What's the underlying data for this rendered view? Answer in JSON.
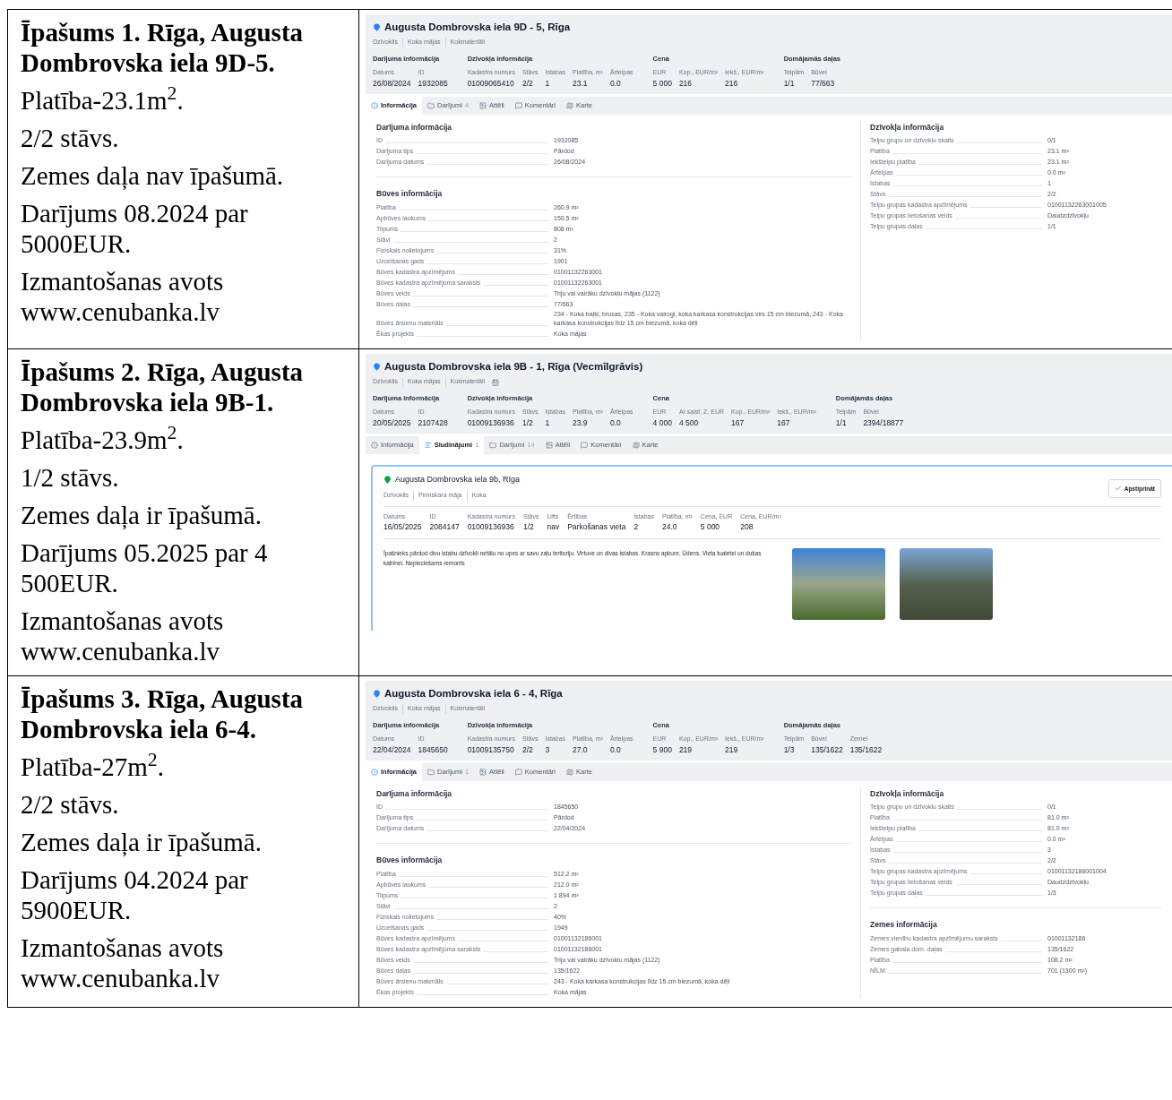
{
  "rows": [
    {
      "property": {
        "title": "Īpašums 1. Rīga, Augusta Dombrovska iela 9D-5.",
        "lines": [
          "Platība-23.1m$^{2}$.",
          "2/2 stāvs.",
          "Zemes daļa nav īpašumā.",
          "Darījums 08.2024 par 5000EUR.",
          "Izmantošanas avots www.cenubanka.lv"
        ]
      },
      "screenshot": {
        "address": "Augusta Dombrovska iela 9D - 5, Rīga",
        "tags": [
          "Dzīvoklis",
          "Koka mājas",
          "Kokmateriāli"
        ],
        "extra_icon": false,
        "summary": [
          {
            "title": "Darījuma informācija",
            "fields": [
              {
                "label": "Datums",
                "value": "26/08/2024"
              },
              {
                "label": "ID",
                "value": "1932085"
              }
            ]
          },
          {
            "title": "Dzīvokļa informācija",
            "fields": [
              {
                "label": "Kadastra numurs",
                "value": "01009065410"
              },
              {
                "label": "Stāvs",
                "value": "2/2"
              },
              {
                "label": "Istabas",
                "value": "1"
              },
              {
                "label": "Platība, m²",
                "value": "23.1"
              },
              {
                "label": "Ārtelpas",
                "value": "0.0"
              }
            ]
          },
          {
            "title": "Cena",
            "fields": [
              {
                "label": "EUR",
                "value": "5 000"
              },
              {
                "label": "Kop., EUR/m²",
                "value": "216"
              },
              {
                "label": "Iekš., EUR/m²",
                "value": "216"
              }
            ]
          },
          {
            "title": "Domājamās daļas",
            "fields": [
              {
                "label": "Telpām",
                "value": "1/1"
              },
              {
                "label": "Būvei",
                "value": "77/663"
              }
            ]
          }
        ],
        "tabs": [
          {
            "kind": "info",
            "label": "Informācija",
            "selected": true
          },
          {
            "kind": "deals",
            "label": "Darījumi",
            "count": "4",
            "selected": false
          },
          {
            "kind": "images",
            "label": "Attēli",
            "selected": false
          },
          {
            "kind": "comments",
            "label": "Komentāri",
            "selected": false
          },
          {
            "kind": "map",
            "label": "Karte",
            "selected": false
          }
        ],
        "body": {
          "kind": "info",
          "columns": [
            [
              {
                "title": "Darījuma informācija",
                "rows": [
                  {
                    "label": "ID",
                    "value": "1932085"
                  },
                  {
                    "label": "Darījuma tips",
                    "value": "Pārdod"
                  },
                  {
                    "label": "Darījuma datums",
                    "value": "26/08/2024"
                  }
                ]
              },
              {
                "title": "Būves informācija",
                "rows": [
                  {
                    "label": "Platība",
                    "value": "260.9 m²"
                  },
                  {
                    "label": "Apbūves laukums",
                    "value": "150.5 m²"
                  },
                  {
                    "label": "Tilpums",
                    "value": "808 m³"
                  },
                  {
                    "label": "Stāvi",
                    "value": "2"
                  },
                  {
                    "label": "Fiziskais nolietojums",
                    "value": "31%"
                  },
                  {
                    "label": "Uzcelšanas gads",
                    "value": "1901"
                  },
                  {
                    "label": "Būves kadastra apzīmējums",
                    "value": "01001132263001"
                  },
                  {
                    "label": "Būves kadastra apzīmējuma saraksts",
                    "value": "01001132263001"
                  },
                  {
                    "label": "Būves veids",
                    "value": "Triju vai vairāku dzīvokļu mājas (1122)"
                  },
                  {
                    "label": "Būves daļas",
                    "value": "77/663"
                  },
                  {
                    "label": "Būves ārsienu materiāls",
                    "value": "234 - Koka baļķi, brusas, 235 - Koka vairogi, koka karkasa konstrukcijas virs 15 cm biezumā, 243 - Koka karkasa konstrukcijas līdz 15 cm biezumā, koka dēļi"
                  },
                  {
                    "label": "Ēkas projekts",
                    "value": "Koka mājas"
                  }
                ]
              }
            ],
            [
              {
                "title": "Dzīvokļa informācija",
                "rows": [
                  {
                    "label": "Telpu grupu un dzīvokļu skaits",
                    "value": "0/1"
                  },
                  {
                    "label": "Platība",
                    "value": "23.1 m²"
                  },
                  {
                    "label": "Iekštelpu platība",
                    "value": "23.1 m²"
                  },
                  {
                    "label": "Ārtelpas",
                    "value": "0.0 m²"
                  },
                  {
                    "label": "Istabas",
                    "value": "1"
                  },
                  {
                    "label": "Stāvs",
                    "value": "2/2"
                  },
                  {
                    "label": "Telpu grupas kadastra apzīmējums",
                    "value": "01001132263001005"
                  },
                  {
                    "label": "Telpu grupas lietošanas veids",
                    "value": "Daudzdzīvokļu"
                  },
                  {
                    "label": "Telpu grupas daļas",
                    "value": "1/1"
                  }
                ]
              }
            ]
          ]
        }
      }
    },
    {
      "property": {
        "title": "Īpašums 2. Rīga, Augusta Dombrovska iela 9B-1.",
        "lines": [
          "Platība-23.9m$^{2}$.",
          "1/2 stāvs.",
          "Zemes daļa ir īpašumā.",
          "Darījums 05.2025 par 4 500EUR.",
          "Izmantošanas avots www.cenubanka.lv"
        ]
      },
      "screenshot": {
        "address": "Augusta Dombrovska iela 9B - 1, Rīga (Vecmīlgrāvis)",
        "tags": [
          "Dzīvoklis",
          "Koka mājas",
          "Kokmateriāli"
        ],
        "extra_icon": true,
        "summary": [
          {
            "title": "Darījuma informācija",
            "fields": [
              {
                "label": "Datums",
                "value": "20/05/2025"
              },
              {
                "label": "ID",
                "value": "2107428"
              }
            ]
          },
          {
            "title": "Dzīvokļa informācija",
            "fields": [
              {
                "label": "Kadastra numurs",
                "value": "01009136936"
              },
              {
                "label": "Stāvs",
                "value": "1/2"
              },
              {
                "label": "Istabas",
                "value": "1"
              },
              {
                "label": "Platība, m²",
                "value": "23.9"
              },
              {
                "label": "Ārtelpas",
                "value": "0.0"
              }
            ]
          },
          {
            "title": "Cena",
            "fields": [
              {
                "label": "EUR",
                "value": "4 000"
              },
              {
                "label": "Ar saist. Z, EUR",
                "value": "4 500"
              },
              {
                "label": "Kop., EUR/m²",
                "value": "167"
              },
              {
                "label": "Iekš., EUR/m²",
                "value": "167"
              }
            ]
          },
          {
            "title": "Domājamās daļas",
            "fields": [
              {
                "label": "Telpām",
                "value": "1/1"
              },
              {
                "label": "Būvei",
                "value": "2394/18877"
              }
            ]
          }
        ],
        "tabs": [
          {
            "kind": "info",
            "label": "Informācija",
            "selected": false
          },
          {
            "kind": "listings",
            "label": "Sludinājumi",
            "count": "1",
            "selected": true
          },
          {
            "kind": "deals",
            "label": "Darījumi",
            "count": "14",
            "selected": false
          },
          {
            "kind": "images",
            "label": "Attēli",
            "selected": false
          },
          {
            "kind": "comments",
            "label": "Komentāri",
            "selected": false
          },
          {
            "kind": "map",
            "label": "Karte",
            "selected": false
          }
        ],
        "body": {
          "kind": "listing",
          "address": "Augusta Dombrovska iela 9b, Rīga",
          "tags": [
            "Dzīvoklis",
            "Pirmskara māja",
            "Koka"
          ],
          "button": "Apstiprināt",
          "fields": [
            {
              "label": "Datums",
              "value": "16/05/2025"
            },
            {
              "label": "ID",
              "value": "2084147"
            },
            {
              "label": "Kadastra numurs",
              "value": "01009136936"
            },
            {
              "label": "Stāvs",
              "value": "1/2"
            },
            {
              "label": "Lifts",
              "value": "nav"
            },
            {
              "label": "Ērtības",
              "value": "Parkošanas vieta"
            },
            {
              "label": "Istabas",
              "value": "2"
            },
            {
              "label": "Platība, m²",
              "value": "24.0"
            },
            {
              "label": "Cena, EUR",
              "value": "5 000"
            },
            {
              "label": "Cena, EUR/m²",
              "value": "208"
            }
          ],
          "description": "Īpašnieks pārdod divu istabu dzīvokli netālu no upes ar savu zaļu teritoriju. Virtuve un divas istabas. Krasns apkure. Ūdens. Vieta tualetei un dušas kabīnei. Nepieciešams remonts"
        }
      }
    },
    {
      "property": {
        "title": "Īpašums 3. Rīga, Augusta Dombrovska iela 6-4.",
        "lines": [
          "Platība-27m$^{2}$.",
          "2/2 stāvs.",
          "Zemes daļa ir īpašumā.",
          "Darījums 04.2024 par 5900EUR.",
          "Izmantošanas avots www.cenubanka.lv"
        ]
      },
      "screenshot": {
        "address": "Augusta Dombrovska iela 6 - 4, Rīga",
        "tags": [
          "Dzīvoklis",
          "Koka mājas",
          "Kokmateriāli"
        ],
        "extra_icon": false,
        "summary": [
          {
            "title": "Darījuma informācija",
            "fields": [
              {
                "label": "Datums",
                "value": "22/04/2024"
              },
              {
                "label": "ID",
                "value": "1845650"
              }
            ]
          },
          {
            "title": "Dzīvokļa informācija",
            "fields": [
              {
                "label": "Kadastra numurs",
                "value": "01009135750"
              },
              {
                "label": "Stāvs",
                "value": "2/2"
              },
              {
                "label": "Istabas",
                "value": "3"
              },
              {
                "label": "Platība, m²",
                "value": "27.0"
              },
              {
                "label": "Ārtelpas",
                "value": "0.0"
              }
            ]
          },
          {
            "title": "Cena",
            "fields": [
              {
                "label": "EUR",
                "value": "5 900"
              },
              {
                "label": "Kop., EUR/m²",
                "value": "219"
              },
              {
                "label": "Iekš., EUR/m²",
                "value": "219"
              }
            ]
          },
          {
            "title": "Domājamās daļas",
            "fields": [
              {
                "label": "Telpām",
                "value": "1/3"
              },
              {
                "label": "Būvei",
                "value": "135/1622"
              },
              {
                "label": "Zemei",
                "value": "135/1622"
              }
            ]
          }
        ],
        "tabs": [
          {
            "kind": "info",
            "label": "Informācija",
            "selected": true
          },
          {
            "kind": "deals",
            "label": "Darījumi",
            "count": "1",
            "selected": false
          },
          {
            "kind": "images",
            "label": "Attēli",
            "selected": false
          },
          {
            "kind": "comments",
            "label": "Komentāri",
            "selected": false
          },
          {
            "kind": "map",
            "label": "Karte",
            "selected": false
          }
        ],
        "body": {
          "kind": "info",
          "columns": [
            [
              {
                "title": "Darījuma informācija",
                "rows": [
                  {
                    "label": "ID",
                    "value": "1845650"
                  },
                  {
                    "label": "Darījuma tips",
                    "value": "Pārdod"
                  },
                  {
                    "label": "Darījuma datums",
                    "value": "22/04/2024"
                  }
                ]
              },
              {
                "title": "Būves informācija",
                "rows": [
                  {
                    "label": "Platība",
                    "value": "512.2 m²"
                  },
                  {
                    "label": "Apbūves laukums",
                    "value": "212.0 m²"
                  },
                  {
                    "label": "Tilpums",
                    "value": "1 894 m³"
                  },
                  {
                    "label": "Stāvi",
                    "value": "2"
                  },
                  {
                    "label": "Fiziskais nolietojums",
                    "value": "40%"
                  },
                  {
                    "label": "Uzcelšanas gads",
                    "value": "1949"
                  },
                  {
                    "label": "Būves kadastra apzīmējums",
                    "value": "01001132186001"
                  },
                  {
                    "label": "Būves kadastra apzīmējuma saraksts",
                    "value": "01001132186001"
                  },
                  {
                    "label": "Būves veids",
                    "value": "Triju vai vairāku dzīvokļu mājas (1122)"
                  },
                  {
                    "label": "Būves daļas",
                    "value": "135/1622"
                  },
                  {
                    "label": "Būves ārsienu materiāls",
                    "value": "243 - Koka karkasa konstrukcijas līdz 15 cm biezumā, koka dēļi"
                  },
                  {
                    "label": "Ēkas projekts",
                    "value": "Koka mājas"
                  }
                ]
              }
            ],
            [
              {
                "title": "Dzīvokļa informācija",
                "rows": [
                  {
                    "label": "Telpu grupu un dzīvokļu skaits",
                    "value": "0/1"
                  },
                  {
                    "label": "Platība",
                    "value": "81.0 m²"
                  },
                  {
                    "label": "Iekštelpu platība",
                    "value": "81.0 m²"
                  },
                  {
                    "label": "Ārtelpas",
                    "value": "0.0 m²"
                  },
                  {
                    "label": "Istabas",
                    "value": "3"
                  },
                  {
                    "label": "Stāvs",
                    "value": "2/2"
                  },
                  {
                    "label": "Telpu grupas kadastra apzīmējums",
                    "value": "01001132186001004"
                  },
                  {
                    "label": "Telpu grupas lietošanas veids",
                    "value": "Daudzdzīvokļu"
                  },
                  {
                    "label": "Telpu grupas daļas",
                    "value": "1/3"
                  }
                ]
              },
              {
                "title": "Zemes informācija",
                "rows": [
                  {
                    "label": "Zemes vienību kadastra apzīmējumu saraksts",
                    "value": "01001132186"
                  },
                  {
                    "label": "Zemes gabala dom. daļas",
                    "value": "135/1622"
                  },
                  {
                    "label": "Platība",
                    "value": "108.2 m²"
                  },
                  {
                    "label": "NĪLM",
                    "value": "701 (1300 m²)"
                  }
                ]
              }
            ]
          ]
        }
      }
    }
  ]
}
